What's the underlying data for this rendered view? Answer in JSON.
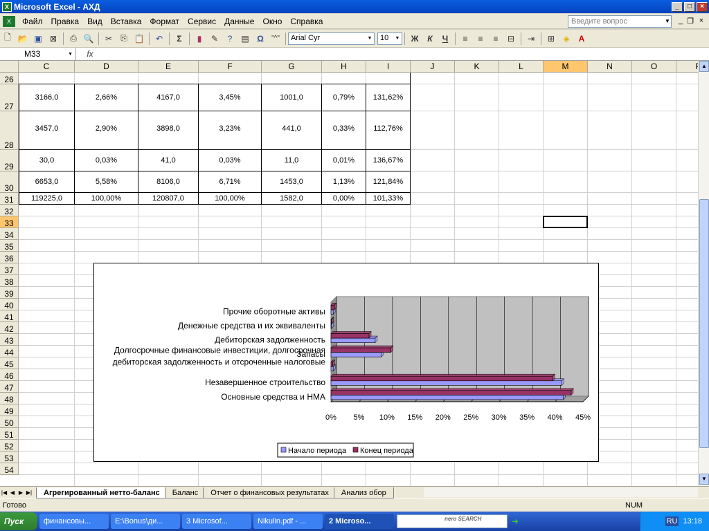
{
  "window": {
    "title": "Microsoft Excel - АХД"
  },
  "menu": [
    "Файл",
    "Правка",
    "Вид",
    "Вставка",
    "Формат",
    "Сервис",
    "Данные",
    "Окно",
    "Справка"
  ],
  "ask_placeholder": "Введите вопрос",
  "toolbar": {
    "font": "Arial Cyr",
    "size": "10",
    "autosum": "Σ",
    "bold": "Ж",
    "italic": "К",
    "underline": "Ч",
    "omega": "Ω",
    "quote": "\"^\""
  },
  "formula": {
    "namebox": "M33",
    "fx": "fx"
  },
  "columns": [
    "C",
    "D",
    "E",
    "F",
    "G",
    "H",
    "I",
    "J",
    "K",
    "L",
    "M",
    "N",
    "O",
    "P"
  ],
  "rows": [
    "26",
    "27",
    "28",
    "29",
    "30",
    "31",
    "32",
    "33",
    "34",
    "35",
    "36",
    "37",
    "38",
    "39",
    "40",
    "41",
    "42",
    "43",
    "44",
    "45",
    "46",
    "47",
    "48",
    "49",
    "50",
    "51",
    "52",
    "53",
    "54"
  ],
  "table": [
    [
      "3166,0",
      "2,66%",
      "4167,0",
      "3,45%",
      "1001,0",
      "0,79%",
      "131,62%"
    ],
    [
      "3457,0",
      "2,90%",
      "3898,0",
      "3,23%",
      "441,0",
      "0,33%",
      "112,76%"
    ],
    [
      "30,0",
      "0,03%",
      "41,0",
      "0,03%",
      "11,0",
      "0,01%",
      "136,67%"
    ],
    [
      "6653,0",
      "5,58%",
      "8106,0",
      "6,71%",
      "1453,0",
      "1,13%",
      "121,84%"
    ],
    [
      "119225,0",
      "100,00%",
      "120807,0",
      "100,00%",
      "1582,0",
      "0,00%",
      "101,33%"
    ]
  ],
  "chart_data": {
    "type": "bar",
    "orientation": "horizontal",
    "categories": [
      "Основные средства и НМА",
      "Незавершенное строительство",
      "Долгосрочные финансовые инвестиции, долгосрочная дебиторская задолженность и отсроченные налоговые",
      "Запасы",
      "Дебиторская задолженность",
      "Денежные средства и их эквиваленты",
      "Прочие оборотные активы"
    ],
    "category_label_lines": [
      [
        "Основные средства и НМА"
      ],
      [
        "Незавершенное строительство"
      ],
      [
        "Долгосрочные финансовые инвестиции, долгосрочная",
        "дебиторская задолженность и отсроченные налоговые"
      ],
      [
        "Запасы"
      ],
      [
        "Дебиторская задолженность"
      ],
      [
        "Денежные средства и их эквиваленты"
      ],
      [
        "Прочие оборотные активы"
      ]
    ],
    "series": [
      {
        "name": "Начало периода",
        "color": "#9999ff",
        "values": [
          41.5,
          41.2,
          0.4,
          9.0,
          7.9,
          0.1,
          0.4
        ]
      },
      {
        "name": "Конец периода",
        "color": "#993366",
        "values": [
          42.9,
          39.6,
          0.3,
          10.7,
          6.8,
          0.1,
          0.6
        ]
      }
    ],
    "x_ticks": [
      "0%",
      "5%",
      "10%",
      "15%",
      "20%",
      "25%",
      "30%",
      "35%",
      "40%",
      "45%"
    ],
    "xlim": [
      0,
      45
    ],
    "grid": true,
    "legend": "bottom"
  },
  "sheets": [
    "Агрегированный нетто-баланс",
    "Баланс",
    "Отчет о финансовых результатах",
    "Анализ обор"
  ],
  "status": {
    "ready": "Готово",
    "num": "NUM"
  },
  "taskbar": {
    "start": "Пуск",
    "tasks": [
      "финансовы...",
      "E:\\Bonus\\ди...",
      "3 Microsof...",
      "Nikulin.pdf - ...",
      "2 Microso..."
    ],
    "nero": "nero SEARCH",
    "lang": "RU",
    "clock": "13:18"
  }
}
